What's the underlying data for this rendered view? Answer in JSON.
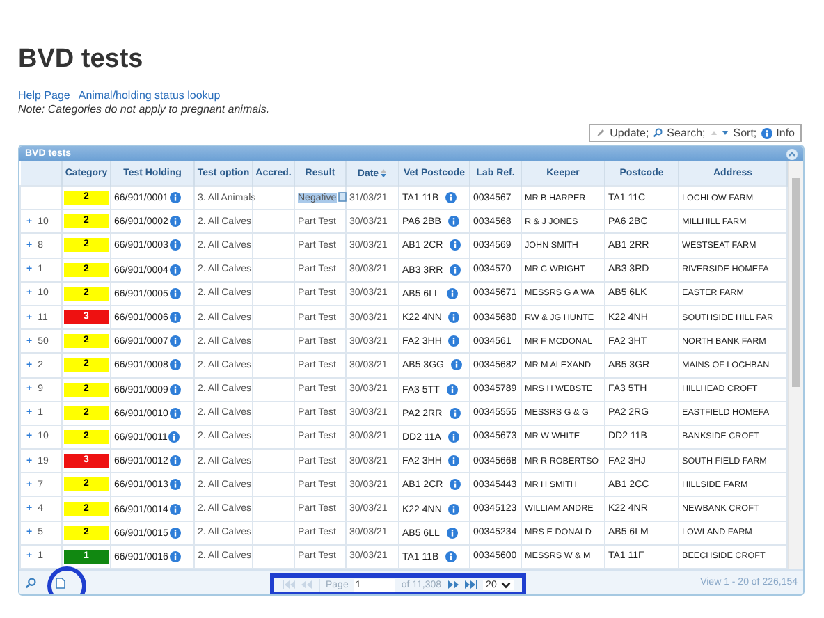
{
  "page_title": "BVD tests",
  "links": [
    "Help Page",
    "Animal/holding status lookup"
  ],
  "note": "Note: Categories do not apply to pregnant animals.",
  "toolbar": [
    {
      "kind": "update",
      "label": "Update;"
    },
    {
      "kind": "search",
      "label": "Search;"
    },
    {
      "kind": "sort",
      "label": "Sort;"
    },
    {
      "kind": "info",
      "label": "Info"
    }
  ],
  "grid": {
    "caption": "BVD tests",
    "columns": [
      {
        "label": "Category",
        "sorted": false
      },
      {
        "label": "Test Holding",
        "sorted": false
      },
      {
        "label": "Test option",
        "sorted": false
      },
      {
        "label": "Accred.",
        "sorted": false
      },
      {
        "label": "Result",
        "sorted": false
      },
      {
        "label": "Date",
        "sorted": true
      },
      {
        "label": "Vet Postcode",
        "sorted": false
      },
      {
        "label": "Lab Ref.",
        "sorted": false
      },
      {
        "label": "Keeper",
        "sorted": false
      },
      {
        "label": "Postcode",
        "sorted": false
      },
      {
        "label": "Address",
        "sorted": false
      }
    ],
    "rows": [
      {
        "count": "",
        "category": "2",
        "color": "#ffff00",
        "holding": "66/901/0001",
        "option": "3. All Animals",
        "result": "Negative",
        "highlighted": true,
        "date": "31/03/21",
        "vet_postcode": "TA1 11B",
        "lab_ref": "0034567",
        "keeper": "MR B HARPER",
        "postcode": "TA1 11C",
        "address": "LOCHLOW FARM"
      },
      {
        "toggle": "+",
        "count": "10",
        "category": "2",
        "color": "#ffff00",
        "holding": "66/901/0002",
        "option": "2. All Calves",
        "result": "Part Test",
        "highlighted": false,
        "date": "30/03/21",
        "vet_postcode": "PA6 2BB",
        "lab_ref": "0034568",
        "keeper": "R & J JONES",
        "postcode": "PA6 2BC",
        "address": "MILLHILL FARM"
      },
      {
        "toggle": "+",
        "count": "8",
        "category": "2",
        "color": "#ffff00",
        "holding": "66/901/0003",
        "option": "2. All Calves",
        "result": "Part Test",
        "highlighted": false,
        "date": "30/03/21",
        "vet_postcode": "AB1 2CR",
        "lab_ref": "0034569",
        "keeper": "JOHN SMITH",
        "postcode": "AB1 2RR",
        "address": "WESTSEAT FARM"
      },
      {
        "toggle": "+",
        "count": "1",
        "category": "2",
        "color": "#ffff00",
        "holding": "66/901/0004",
        "option": "2. All Calves",
        "result": "Part Test",
        "highlighted": false,
        "date": "30/03/21",
        "vet_postcode": "AB3 3RR",
        "lab_ref": "0034570",
        "keeper": "MR C WRIGHT",
        "postcode": "AB3 3RD",
        "address": "RIVERSIDE HOMEFA"
      },
      {
        "toggle": "+",
        "count": "10",
        "category": "2",
        "color": "#ffff00",
        "holding": "66/901/0005",
        "option": "2. All Calves",
        "result": "Part Test",
        "highlighted": false,
        "date": "30/03/21",
        "vet_postcode": "AB5 6LL",
        "lab_ref": "00345671",
        "keeper": "MESSRS G A WA",
        "postcode": "AB5 6LK",
        "address": "EASTER FARM"
      },
      {
        "toggle": "+",
        "count": "11",
        "category": "3",
        "color": "#ee1111",
        "holding": "66/901/0006",
        "option": "2. All Calves",
        "result": "Part Test",
        "highlighted": false,
        "date": "30/03/21",
        "vet_postcode": "K22 4NN",
        "lab_ref": "00345680",
        "keeper": "RW & JG HUNTE",
        "postcode": "K22 4NH",
        "address": "SOUTHSIDE HILL FAR"
      },
      {
        "toggle": "+",
        "count": "50",
        "category": "2",
        "color": "#ffff00",
        "holding": "66/901/0007",
        "option": "2. All Calves",
        "result": "Part Test",
        "highlighted": false,
        "date": "30/03/21",
        "vet_postcode": "FA2 3HH",
        "lab_ref": "0034561",
        "keeper": "MR F MCDONAL",
        "postcode": "FA2 3HT",
        "address": "NORTH BANK FARM"
      },
      {
        "toggle": "+",
        "count": "2",
        "category": "2",
        "color": "#ffff00",
        "holding": "66/901/0008",
        "option": "2. All Calves",
        "result": "Part Test",
        "highlighted": false,
        "date": "30/03/21",
        "vet_postcode": "AB5 3GG",
        "lab_ref": "00345682",
        "keeper": "MR M ALEXAND",
        "postcode": "AB5 3GR",
        "address": "MAINS OF LOCHBAN"
      },
      {
        "toggle": "+",
        "count": "9",
        "category": "2",
        "color": "#ffff00",
        "holding": "66/901/0009",
        "option": "2. All Calves",
        "result": "Part Test",
        "highlighted": false,
        "date": "30/03/21",
        "vet_postcode": "FA3 5TT",
        "lab_ref": "00345789",
        "keeper": "MRS H WEBSTE",
        "postcode": "FA3 5TH",
        "address": "HILLHEAD CROFT"
      },
      {
        "toggle": "+",
        "count": "1",
        "category": "2",
        "color": "#ffff00",
        "holding": "66/901/0010",
        "option": "2. All Calves",
        "result": "Part Test",
        "highlighted": false,
        "date": "30/03/21",
        "vet_postcode": "PA2 2RR",
        "lab_ref": "00345555",
        "keeper": "MESSRS G & G",
        "postcode": "PA2 2RG",
        "address": "EASTFIELD HOMEFA"
      },
      {
        "toggle": "+",
        "count": "10",
        "category": "2",
        "color": "#ffff00",
        "holding": "66/901/0011",
        "option": "2. All Calves",
        "result": "Part Test",
        "highlighted": false,
        "date": "30/03/21",
        "vet_postcode": "DD2 11A",
        "lab_ref": "00345673",
        "keeper": "MR W WHITE",
        "postcode": "DD2 11B",
        "address": "BANKSIDE CROFT"
      },
      {
        "toggle": "+",
        "count": "19",
        "category": "3",
        "color": "#ee1111",
        "holding": "66/901/0012",
        "option": "2. All Calves",
        "result": "Part Test",
        "highlighted": false,
        "date": "30/03/21",
        "vet_postcode": "FA2 3HH",
        "lab_ref": "00345668",
        "keeper": "MR R ROBERTSO",
        "postcode": "FA2 3HJ",
        "address": "SOUTH FIELD FARM"
      },
      {
        "toggle": "+",
        "count": "7",
        "category": "2",
        "color": "#ffff00",
        "holding": "66/901/0013",
        "option": "2. All Calves",
        "result": "Part Test",
        "highlighted": false,
        "date": "30/03/21",
        "vet_postcode": "AB1 2CR",
        "lab_ref": "00345443",
        "keeper": "MR H SMITH",
        "postcode": "AB1 2CC",
        "address": "HILLSIDE FARM"
      },
      {
        "toggle": "+",
        "count": "4",
        "category": "2",
        "color": "#ffff00",
        "holding": "66/901/0014",
        "option": "2. All Calves",
        "result": "Part Test",
        "highlighted": false,
        "date": "30/03/21",
        "vet_postcode": "K22 4NN",
        "lab_ref": "00345123",
        "keeper": "WILLIAM ANDRE",
        "postcode": "K22 4NR",
        "address": "NEWBANK CROFT"
      },
      {
        "toggle": "+",
        "count": "5",
        "category": "2",
        "color": "#ffff00",
        "holding": "66/901/0015",
        "option": "2. All Calves",
        "result": "Part Test",
        "highlighted": false,
        "date": "30/03/21",
        "vet_postcode": "AB5 6LL",
        "lab_ref": "00345234",
        "keeper": "MRS E DONALD",
        "postcode": "AB5 6LM",
        "address": "LOWLAND FARM"
      },
      {
        "toggle": "+",
        "count": "1",
        "category": "1",
        "color": "#118811",
        "holding": "66/901/0016",
        "option": "2. All Calves",
        "result": "Part Test",
        "highlighted": false,
        "date": "30/03/21",
        "vet_postcode": "TA1 11B",
        "lab_ref": "00345600",
        "keeper": "MESSRS W & M",
        "postcode": "TA1 11F",
        "address": "BEECHSIDE CROFT"
      }
    ],
    "pager": {
      "page_label": "Page",
      "page": "1",
      "of_pages": "of 11,308",
      "page_size": "20",
      "view": "View 1 - 20 of 226,154"
    }
  }
}
